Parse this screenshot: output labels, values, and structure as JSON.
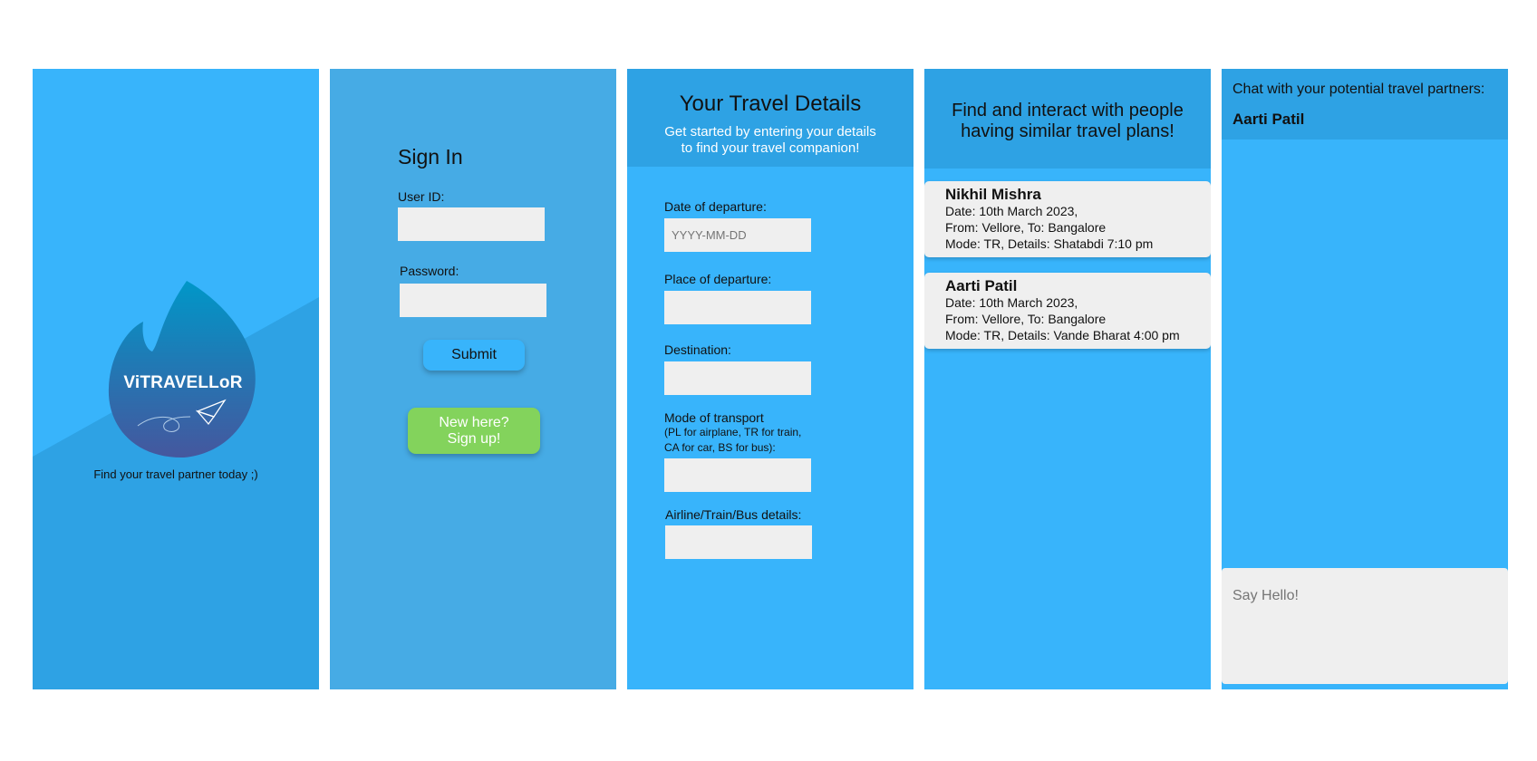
{
  "splash": {
    "app_name": "ViTRAVELLoR",
    "tagline": "Find your travel partner today ;)",
    "colors": {
      "bg_top": "#38b4fb",
      "bg_bottom": "#2ea2e4",
      "logo_top": "#0097c8",
      "logo_bottom": "#45579e"
    }
  },
  "signin": {
    "title": "Sign In",
    "user_id_label": "User ID:",
    "password_label": "Password:",
    "submit_label": "Submit",
    "signup_line1": "New here?",
    "signup_line2": "Sign up!"
  },
  "travel": {
    "title": "Your Travel Details",
    "subtitle_line1": "Get started by entering your details",
    "subtitle_line2": "to find your travel companion!",
    "date_label": "Date of departure:",
    "date_placeholder": "YYYY-MM-DD",
    "place_label": "Place of departure:",
    "destination_label": "Destination:",
    "mode_label": "Mode of transport",
    "mode_note_line1": "(PL for airplane, TR for train,",
    "mode_note_line2": "CA for car, BS for bus):",
    "details_label": "Airline/Train/Bus details:"
  },
  "people": {
    "title_line1": "Find and interact with people",
    "title_line2": "having similar travel plans!",
    "cards": [
      {
        "name": "Nikhil Mishra",
        "date": "Date: 10th March 2023,",
        "route": "From: Vellore, To: Bangalore",
        "mode": "Mode: TR, Details: Shatabdi 7:10 pm"
      },
      {
        "name": "Aarti Patil",
        "date": "Date: 10th March 2023,",
        "route": "From: Vellore, To: Bangalore",
        "mode": "Mode: TR, Details: Vande Bharat 4:00 pm"
      }
    ]
  },
  "chat": {
    "title": "Chat with your potential travel partners:",
    "partner": "Aarti Patil",
    "placeholder": "Say Hello!"
  }
}
